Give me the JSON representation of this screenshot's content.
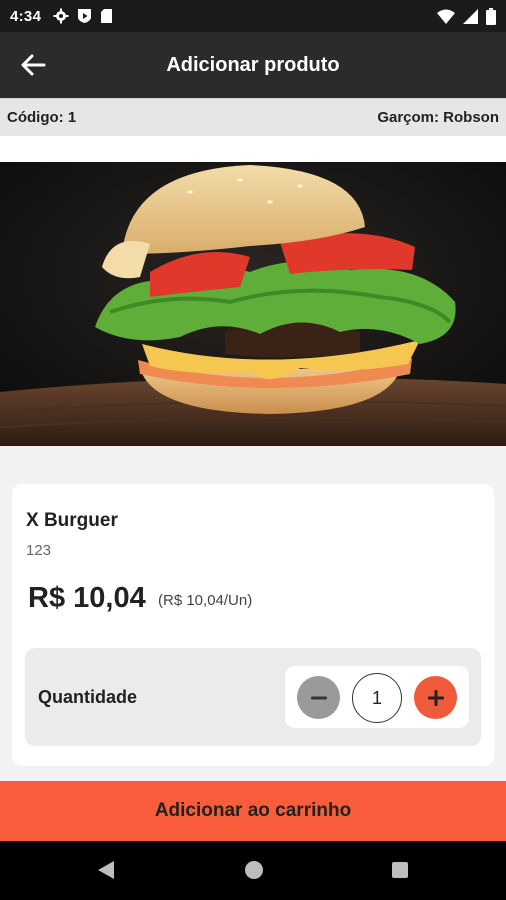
{
  "status_bar": {
    "time": "4:34",
    "left_icons": [
      "gear-icon",
      "play-shield-icon",
      "sd-card-icon"
    ],
    "right_icons": [
      "wifi-icon",
      "signal-icon",
      "battery-icon"
    ]
  },
  "app_bar": {
    "title": "Adicionar produto",
    "back_icon": "arrow-left-icon"
  },
  "info_bar": {
    "code": "Código: 1",
    "waiter": "Garçom: Robson"
  },
  "product": {
    "image": "burger-photo",
    "name": "X Burguer",
    "code": "123",
    "price": "R$ 10,04",
    "unit_price": "(R$ 10,04/Un)"
  },
  "quantity": {
    "label": "Quantidade",
    "value": "1",
    "minus_icon": "minus-icon",
    "plus_icon": "plus-icon"
  },
  "cart_button": {
    "label": "Adicionar ao carrinho"
  },
  "nav_bar": {
    "icons": [
      "back-triangle-icon",
      "home-circle-icon",
      "recents-square-icon"
    ]
  },
  "colors": {
    "accent": "#f95d3c",
    "plus_button": "#f05a3a",
    "minus_button": "#9a9a9a",
    "app_bar": "#2b2b2b",
    "status_bar": "#1b1b1b"
  }
}
